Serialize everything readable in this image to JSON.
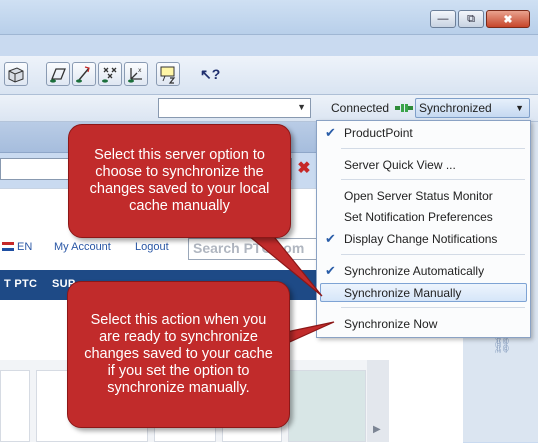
{
  "window": {
    "minimize_glyph": "—",
    "restore_glyph": "⧉",
    "close_glyph": "✖"
  },
  "toolbar": {
    "help_icon_glyph": "↖?"
  },
  "connection": {
    "status_label": "Connected",
    "sync_state": "Synchronized",
    "caret_glyph": "▼"
  },
  "server_menu": {
    "items": [
      {
        "label": "ProductPoint",
        "checked": true
      },
      {
        "label": "Server Quick View ...",
        "checked": false
      },
      {
        "label": "Open Server Status Monitor",
        "checked": false
      },
      {
        "label": "Set Notification Preferences",
        "checked": false
      },
      {
        "label": "Display Change Notifications",
        "checked": true
      },
      {
        "label": "Synchronize Automatically",
        "checked": true
      },
      {
        "label": "Synchronize Manually",
        "checked": false,
        "highlighted": true
      },
      {
        "label": "Synchronize Now",
        "checked": false
      }
    ],
    "check_glyph": "✔"
  },
  "browser": {
    "stop_glyph": "✖",
    "lang": "EN",
    "my_account": "My Account",
    "logout": "Logout",
    "search_placeholder": "Search PTC.com",
    "nav_items": [
      "T PTC",
      "SUP"
    ],
    "scroll_glyph": "▶",
    "chain_glyph": "⛓"
  },
  "callouts": {
    "server_option": "Select this server option to choose to synchronize the changes saved to your local cache manually",
    "sync_now": "Select this action when you are ready to synchronize changes saved to your cache if you set the option to synchronize manually."
  },
  "colors": {
    "callout_fill": "#c12b2b",
    "menu_highlight": "#d6e6f9",
    "nav_bar": "#1e4a86",
    "check": "#2a5da8"
  }
}
